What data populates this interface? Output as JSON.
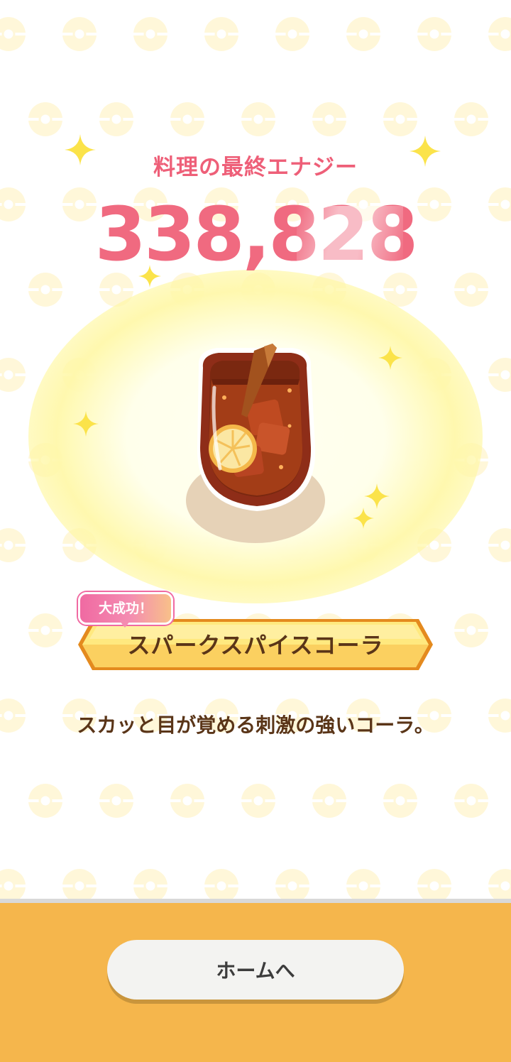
{
  "header": {
    "title": "料理の最終エナジー",
    "energy_value": "338,828"
  },
  "result": {
    "badge_label": "大成功！",
    "recipe_name": "スパークスパイスコーラ",
    "description": "スカッと目が覚める刺激の強いコーラ。"
  },
  "footer": {
    "home_button_label": "ホームへ"
  },
  "icons": {
    "drink": "spark-spice-cola-icon",
    "sparkle": "sparkle-icon",
    "background": "pokeball-pattern"
  },
  "colors": {
    "title": "#ee5f78",
    "energy": "#f06a80",
    "text": "#5a3518",
    "footer": "#f5b64c",
    "banner": "#fbd567",
    "badge": "#f06aa2"
  }
}
